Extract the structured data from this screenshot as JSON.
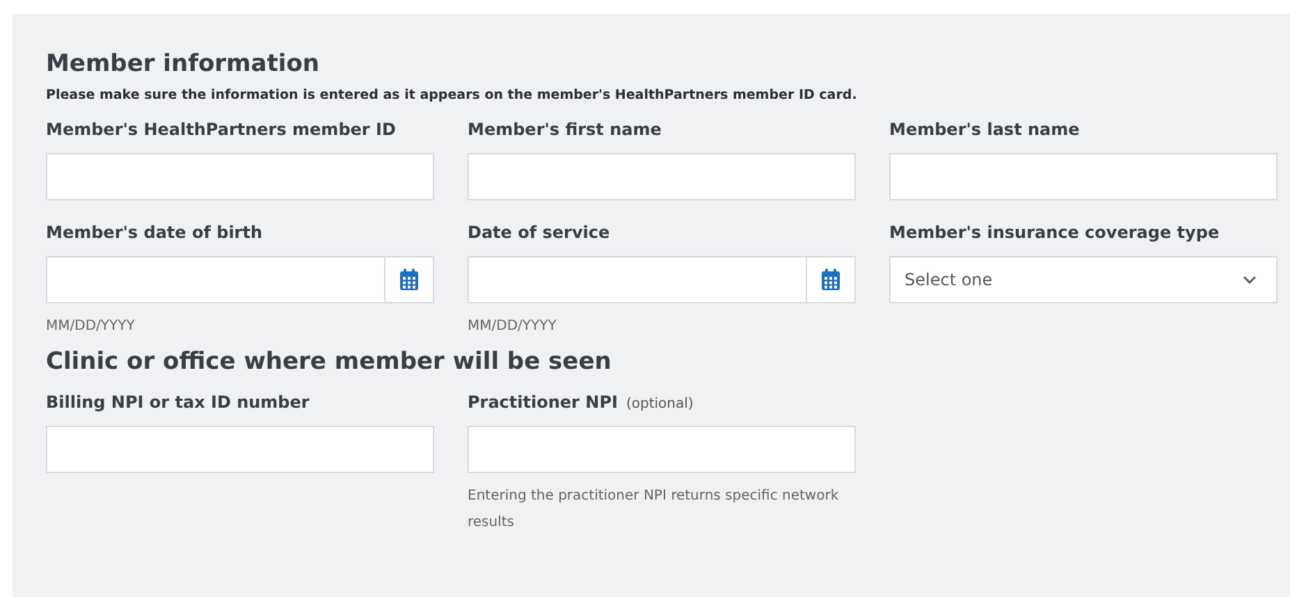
{
  "sections": [
    {
      "heading": "Member information",
      "note": "Please make sure the information is entered as it appears on the member's HealthPartners member ID card.",
      "fields": [
        {
          "kind": "text",
          "label": "Member's HealthPartners member ID"
        },
        {
          "kind": "text",
          "label": "Member's first name"
        },
        {
          "kind": "text",
          "label": "Member's last name"
        },
        {
          "kind": "date",
          "label": "Member's date of birth",
          "hint": "MM/DD/YYYY"
        },
        {
          "kind": "date",
          "label": "Date of service",
          "hint": "MM/DD/YYYY"
        },
        {
          "kind": "select",
          "label": "Member's insurance coverage type",
          "value": "Select one"
        }
      ]
    },
    {
      "heading": "Clinic or office where member will be seen",
      "fields": [
        {
          "kind": "text",
          "label": "Billing NPI or tax ID number"
        },
        {
          "kind": "text",
          "label": "Practitioner NPI",
          "optional": "(optional)",
          "hint": "Entering the practitioner NPI returns specific network results"
        }
      ]
    }
  ]
}
